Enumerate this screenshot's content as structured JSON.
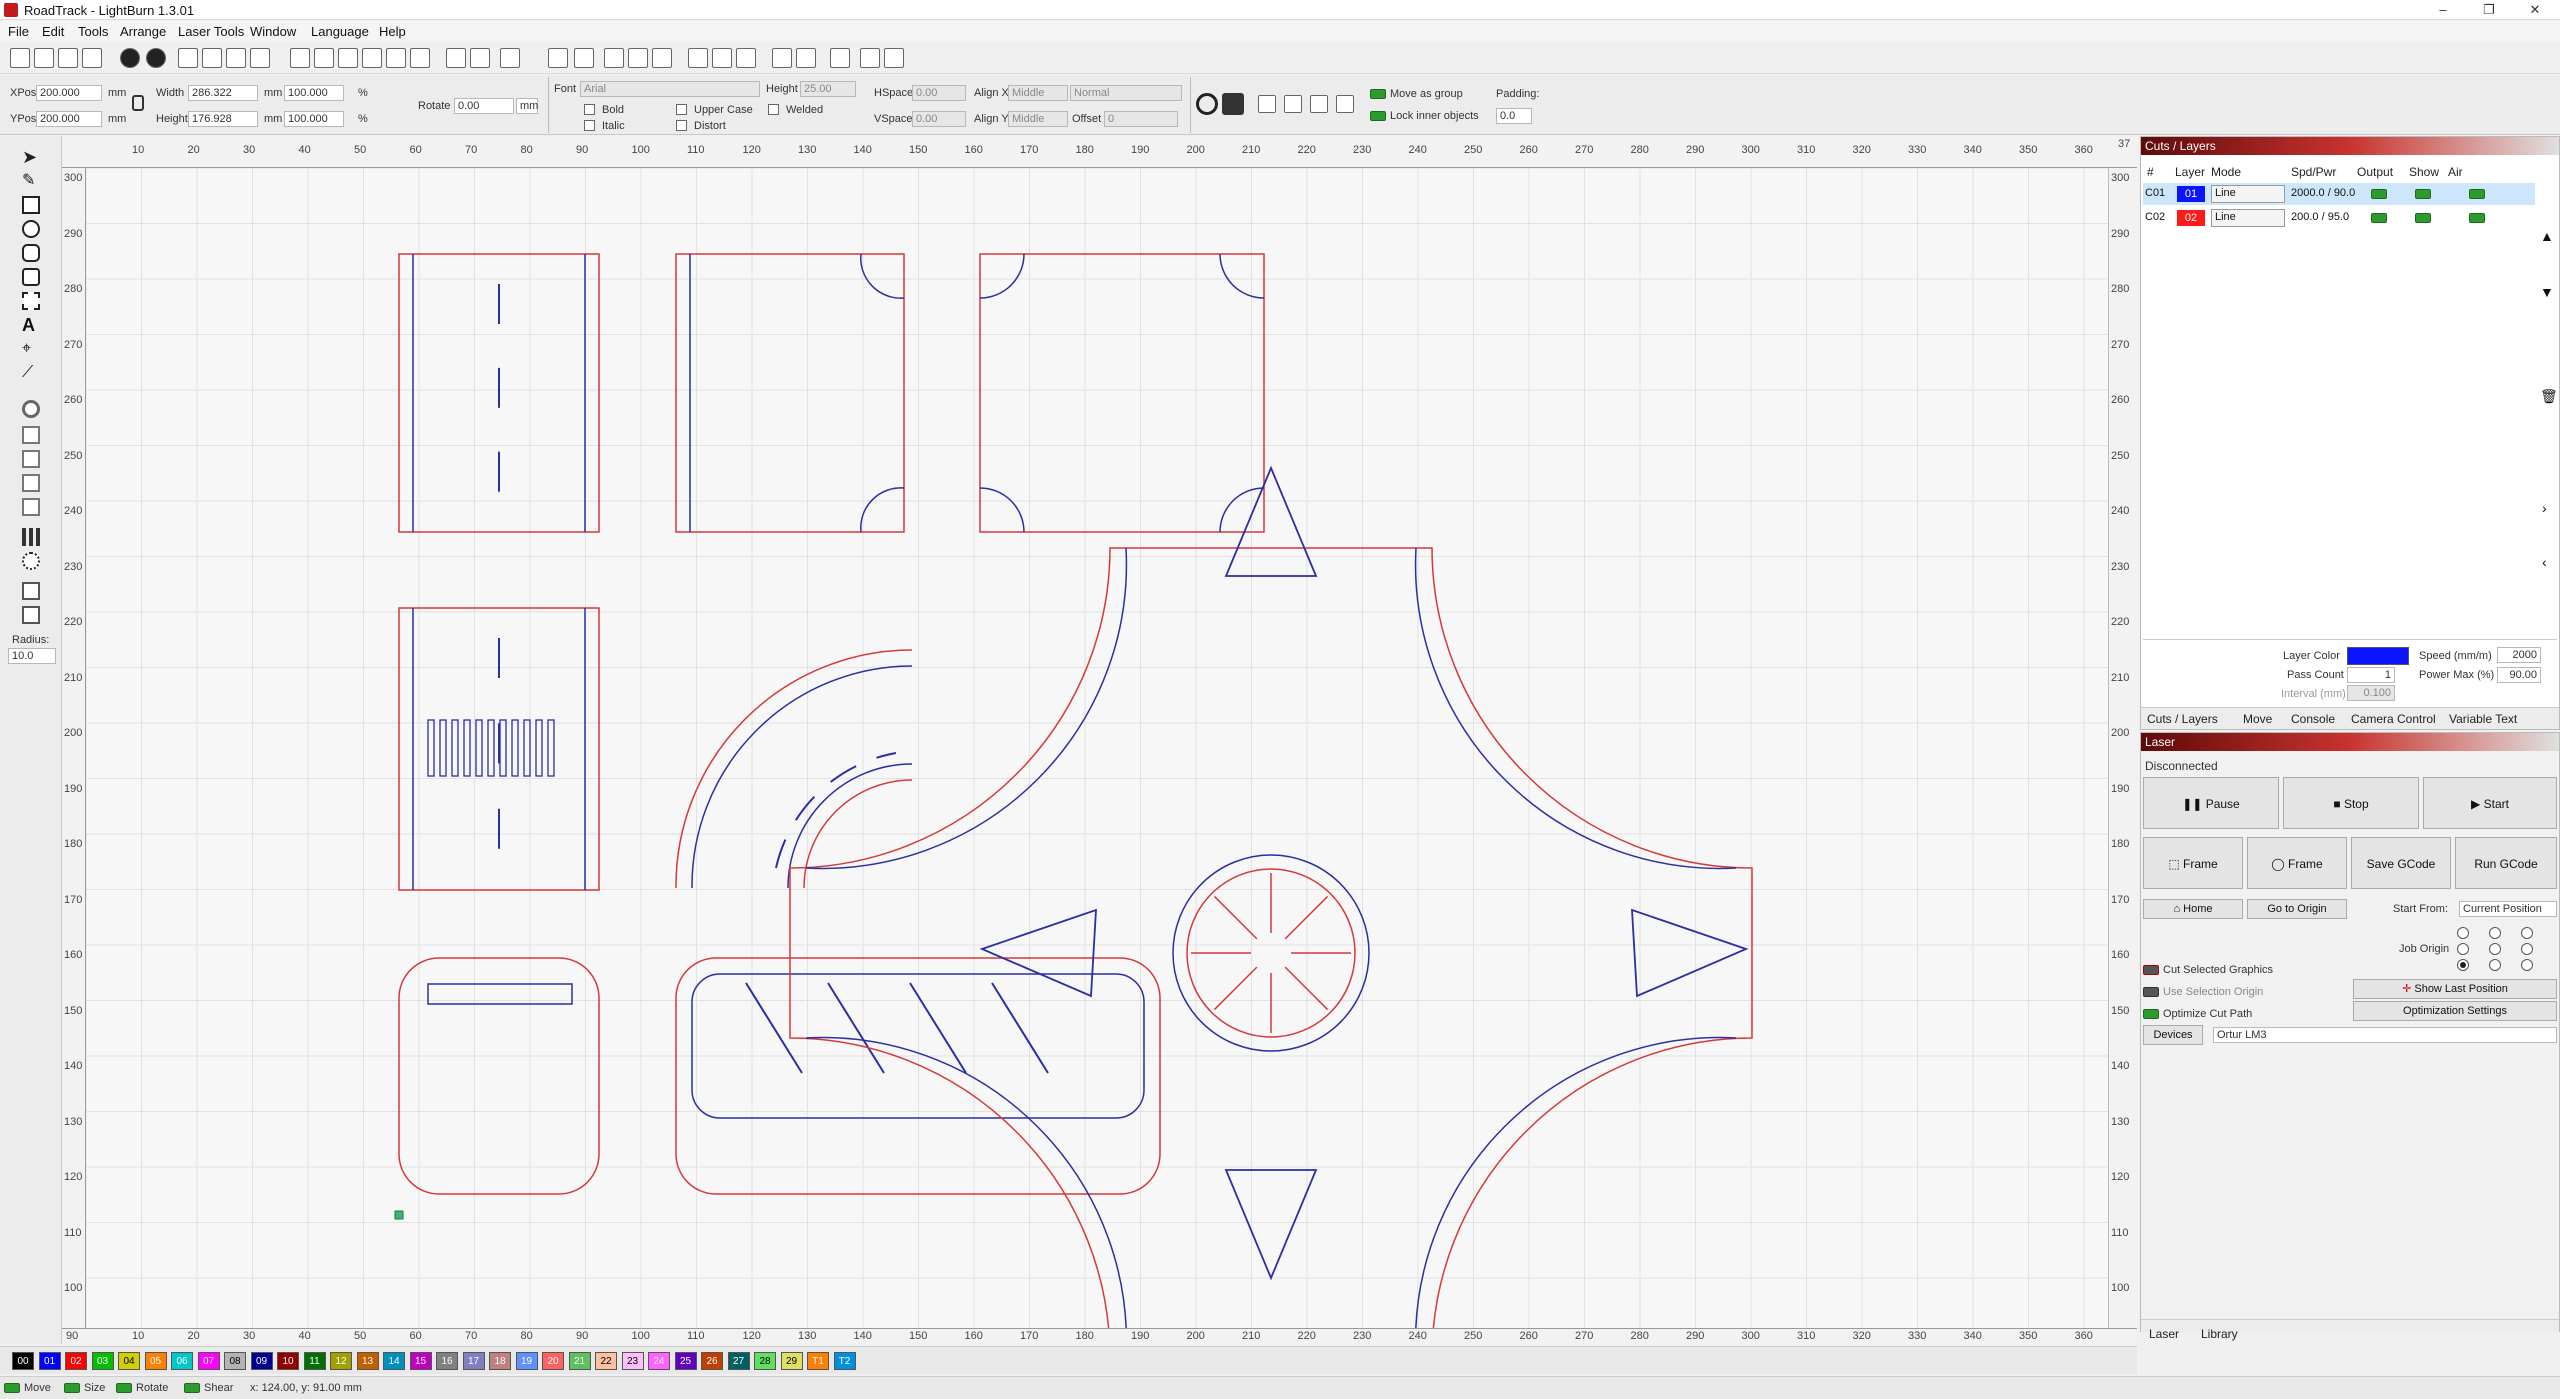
{
  "window": {
    "title": "RoadTrack - LightBurn 1.3.01",
    "minimize": "–",
    "maximize": "❐",
    "close": "✕"
  },
  "menu": [
    "File",
    "Edit",
    "Tools",
    "Arrange",
    "Laser Tools",
    "Window",
    "Language",
    "Help"
  ],
  "numeric_edit": {
    "xpos_label": "XPos",
    "xpos": "200.000",
    "ypos_label": "YPos",
    "ypos": "200.000",
    "width_label": "Width",
    "width": "286.322",
    "height_label": "Height",
    "height": "176.928",
    "unit": "mm",
    "width_pct": "100.000",
    "height_pct": "100.000",
    "pct": "%",
    "rotate_label": "Rotate",
    "rotate": "0.00",
    "units_button": "mm"
  },
  "text_options": {
    "font_label": "Font",
    "font": "Arial",
    "height_label": "Height",
    "height": "25.00",
    "hspace_label": "HSpace",
    "hspace": "0.00",
    "vspace_label": "VSpace",
    "vspace": "0.00",
    "align_x_label": "Align X",
    "align_x": "Middle",
    "align_y_label": "Align Y",
    "align_y": "Middle",
    "mode": "Normal",
    "offset_label": "Offset",
    "offset": "0",
    "bold": "Bold",
    "italic": "Italic",
    "upper_case": "Upper Case",
    "distort": "Distort",
    "welded": "Welded"
  },
  "group_options": {
    "move_as_group": "Move as group",
    "lock_inner": "Lock inner objects",
    "padding_label": "Padding:",
    "padding": "0.0"
  },
  "left_tools": {
    "radius_label": "Radius:",
    "radius": "10.0"
  },
  "ruler": {
    "x_ticks": [
      "10",
      "20",
      "30",
      "40",
      "50",
      "60",
      "70",
      "80",
      "90",
      "100",
      "110",
      "120",
      "130",
      "140",
      "150",
      "160",
      "170",
      "180",
      "190",
      "200",
      "210",
      "220",
      "230",
      "240",
      "250",
      "260",
      "270",
      "280",
      "290",
      "300",
      "310",
      "320",
      "330",
      "340",
      "350",
      "360"
    ],
    "y_ticks": [
      "300",
      "290",
      "280",
      "270",
      "260",
      "250",
      "240",
      "230",
      "220",
      "210",
      "200",
      "190",
      "180",
      "170",
      "160",
      "150",
      "140",
      "130",
      "120",
      "110",
      "100"
    ],
    "origin_label": "90",
    "corner_label": "37"
  },
  "cuts_layers": {
    "title": "Cuts / Layers",
    "headers": [
      "#",
      "Layer",
      "Mode",
      "Spd/Pwr",
      "Output",
      "Show",
      "Air"
    ],
    "rows": [
      {
        "id": "C01",
        "layer": "01",
        "color": "#0a14ff",
        "mode": "Line",
        "spdpwr": "2000.0 / 90.0"
      },
      {
        "id": "C02",
        "layer": "02",
        "color": "#ff1a1a",
        "mode": "Line",
        "spdpwr": "200.0 / 95.0"
      }
    ],
    "layer_color_label": "Layer Color",
    "speed_label": "Speed (mm/m)",
    "speed": "2000",
    "pass_count_label": "Pass Count",
    "pass_count": "1",
    "power_max_label": "Power Max (%)",
    "power_max": "90.00",
    "interval_label": "Interval (mm)",
    "interval": "0.100",
    "tabs": [
      "Cuts / Layers",
      "Move",
      "Console",
      "Camera Control",
      "Variable Text"
    ]
  },
  "laser": {
    "title": "Laser",
    "status": "Disconnected",
    "pause": "Pause",
    "stop": "Stop",
    "start": "Start",
    "frame1": "Frame",
    "frame2": "Frame",
    "save_gcode": "Save GCode",
    "run_gcode": "Run GCode",
    "home": "Home",
    "go_to_origin": "Go to Origin",
    "start_from_label": "Start From:",
    "start_from": "Current Position",
    "job_origin_label": "Job Origin",
    "cut_selected": "Cut Selected Graphics",
    "use_selection_origin": "Use Selection Origin",
    "optimize_cut_path": "Optimize Cut Path",
    "show_last_position": "Show Last Position",
    "optimization_settings": "Optimization Settings",
    "devices": "Devices",
    "device": "Ortur LM3",
    "tabs": [
      "Laser",
      "Library"
    ]
  },
  "palette": [
    {
      "label": "00",
      "color": "#000000"
    },
    {
      "label": "01",
      "color": "#0000ff"
    },
    {
      "label": "02",
      "color": "#ff0000"
    },
    {
      "label": "03",
      "color": "#00c000"
    },
    {
      "label": "04",
      "color": "#d0d000"
    },
    {
      "label": "05",
      "color": "#ff8000"
    },
    {
      "label": "06",
      "color": "#00c8c8"
    },
    {
      "label": "07",
      "color": "#ff00ff"
    },
    {
      "label": "08",
      "color": "#b4b4b4"
    },
    {
      "label": "09",
      "color": "#000090"
    },
    {
      "label": "10",
      "color": "#900000"
    },
    {
      "label": "11",
      "color": "#007000"
    },
    {
      "label": "12",
      "color": "#a0a000"
    },
    {
      "label": "13",
      "color": "#c06000"
    },
    {
      "label": "14",
      "color": "#0090c0"
    },
    {
      "label": "15",
      "color": "#c000c0"
    },
    {
      "label": "16",
      "color": "#808080"
    },
    {
      "label": "17",
      "color": "#8080c0"
    },
    {
      "label": "18",
      "color": "#c08080"
    },
    {
      "label": "19",
      "color": "#6090ff"
    },
    {
      "label": "20",
      "color": "#ff6060"
    },
    {
      "label": "21",
      "color": "#60c060"
    },
    {
      "label": "22",
      "color": "#ffc0a0"
    },
    {
      "label": "23",
      "color": "#ffc0ff"
    },
    {
      "label": "24",
      "color": "#ff60ff"
    },
    {
      "label": "25",
      "color": "#6000c0"
    },
    {
      "label": "26",
      "color": "#c04000"
    },
    {
      "label": "27",
      "color": "#006060"
    },
    {
      "label": "28",
      "color": "#60e060"
    },
    {
      "label": "29",
      "color": "#e0e060"
    },
    {
      "label": "T1",
      "color": "#ff8000"
    },
    {
      "label": "T2",
      "color": "#0090e0"
    }
  ],
  "status": {
    "move": "Move",
    "size": "Size",
    "rotate": "Rotate",
    "shear": "Shear",
    "coords": "x: 124.00, y: 91.00 mm"
  }
}
